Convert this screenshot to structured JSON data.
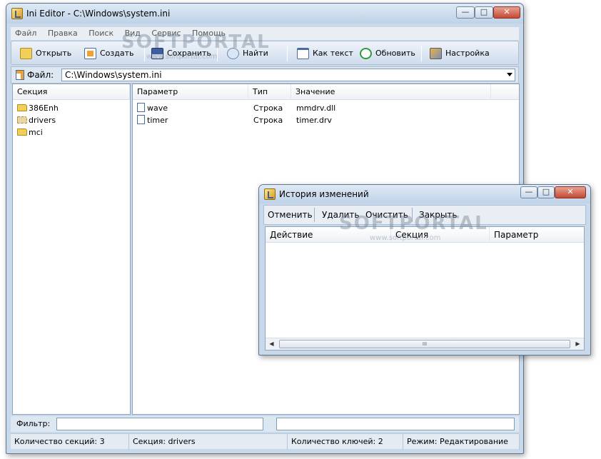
{
  "main_window": {
    "title": "Ini Editor - C:\\Windows\\system.ini",
    "controls": {
      "minimize": "—",
      "maximize": "□",
      "close": "✕"
    }
  },
  "menu": [
    "Файл",
    "Правка",
    "Поиск",
    "Вид",
    "Сервис",
    "Помощь"
  ],
  "toolbar": {
    "open": "Открыть",
    "create": "Создать",
    "save": "Сохранить",
    "find": "Найти",
    "as_text": "Как текст",
    "refresh": "Обновить",
    "settings": "Настройка"
  },
  "file_bar": {
    "label": "Файл:",
    "value": "C:\\Windows\\system.ini"
  },
  "sections": {
    "header": "Секция",
    "items": [
      "386Enh",
      "drivers",
      "mci"
    ]
  },
  "keys": {
    "headers": {
      "param": "Параметр",
      "type": "Тип",
      "value": "Значение"
    },
    "rows": [
      {
        "param": "wave",
        "type": "Строка",
        "value": "mmdrv.dll"
      },
      {
        "param": "timer",
        "type": "Строка",
        "value": "timer.drv"
      }
    ]
  },
  "filter": {
    "label": "Фильтр:",
    "value": ""
  },
  "status": {
    "sections_count": "Количество секций: 3",
    "section": "Секция: drivers",
    "keys_count": "Количество ключей: 2",
    "mode": "Режим: Редактирование"
  },
  "history_window": {
    "title": "История изменений",
    "toolbar": {
      "undo": "Отменить",
      "delete": "Удалить",
      "clear": "Очистить",
      "close": "Закрыть"
    },
    "columns": {
      "action": "Действие",
      "section": "Секция",
      "param": "Параметр"
    },
    "scroll_grip": "III"
  },
  "watermark": {
    "brand": "SOFTPORTAL",
    "url": "www.softportal.com"
  },
  "colors": {
    "accent": "#c9d9ea",
    "close_button": "#c24a34",
    "folder": "#f2cf5a"
  }
}
